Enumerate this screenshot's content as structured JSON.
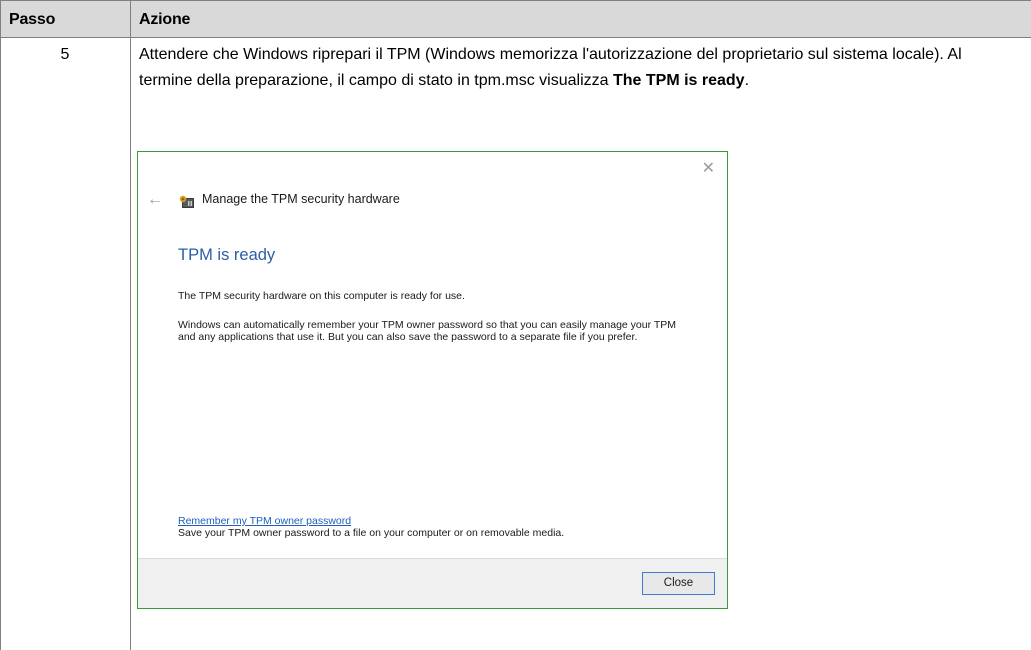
{
  "table": {
    "header": {
      "step_col": "Passo",
      "action_col": "Azione"
    },
    "rows": [
      {
        "step": "5",
        "action_pre": "Attendere che Windows riprepari il TPM (Windows memorizza l'autorizzazione del proprietario sul sistema locale). Al termine della preparazione, il campo di stato in tpm.msc visualizza ",
        "action_bold": "The TPM is ready",
        "action_post": "."
      }
    ]
  },
  "dialog": {
    "close_glyph": "✕",
    "back_glyph": "←",
    "icon": "tpm-security-icon",
    "title": "Manage the TPM security hardware",
    "heading": "TPM is ready",
    "paragraph1": "The TPM security hardware on this computer is ready for use.",
    "paragraph2": "Windows can automatically remember your TPM owner password so that you can easily manage your TPM and any applications that use it. But you can also save the password to a separate file if you prefer.",
    "link_text": "Remember my TPM owner password",
    "link_description": "Save your TPM owner password to a file on your computer or on removable media.",
    "close_button": "Close",
    "colors": {
      "heading": "#2a5ea8",
      "link": "#1f5fbf",
      "border": "#3c9a3c"
    }
  }
}
